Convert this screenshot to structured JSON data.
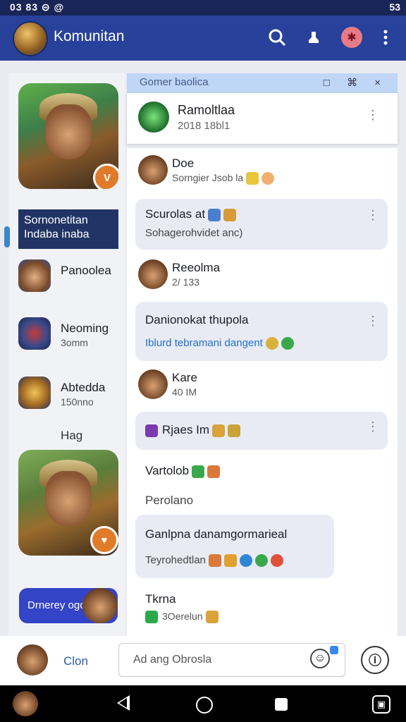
{
  "status_bar": {
    "time": "03 83 ⊝ @",
    "right": "53"
  },
  "app_bar": {
    "title": "Komunitan"
  },
  "sidebar": {
    "banner": "Sornonetitan Indaba inaba",
    "items": [
      {
        "name": "Panoolea",
        "sub": ""
      },
      {
        "name": "Neoming",
        "sub": "3omm"
      },
      {
        "name": "Abtedda",
        "sub": "150nno"
      }
    ],
    "section_label": "Hag",
    "button_label": "Drnerey ogol",
    "badge1": "V",
    "badge2": "♥"
  },
  "thread": {
    "overlay_title": "Gomer baolica",
    "overlay_controls": "□ ⌘ ×",
    "header_name": "Ramoltlaa",
    "header_sub": "2018 18bl1",
    "kebab": "⋮"
  },
  "messages": [
    {
      "name": "Doe",
      "sub": "Sorngier  Jsob la"
    },
    {
      "bubble_title": "Scurolas at",
      "bubble_sub": "Sohagerohvidet anc)"
    },
    {
      "name": "Reeolma",
      "sub": "2/ 133"
    },
    {
      "bubble_title": "Danionokat thupola",
      "bubble_link": "Iblurd tebramani dangent"
    },
    {
      "name": "Kare",
      "sub": "40 IM"
    },
    {
      "bubble_title": "Rjaes Im"
    },
    {
      "plain1": "Vartolob",
      "plain2": "Perolano"
    },
    {
      "bubble_title": "Ganlpna danamgormarieal",
      "bubble_sub": "Teyrohedtlan"
    },
    {
      "name": "Tkrna",
      "sub": "3Oerelun"
    }
  ],
  "composer": {
    "label": "Clon",
    "placeholder": "Ad ang Obrosla",
    "info": "ⓘ"
  },
  "colors": {
    "app_bar": "#28419a",
    "status_bar": "#1a2557",
    "link": "#2a5ab0",
    "sidebar_button": "#3344c7"
  }
}
